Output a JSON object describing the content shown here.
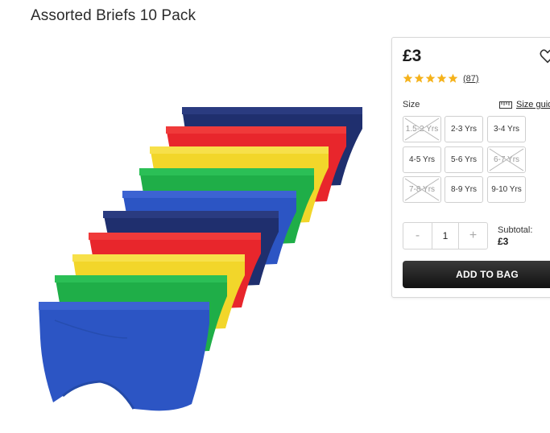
{
  "product": {
    "title": "Assorted Briefs 10 Pack",
    "image_alt": "Ten pairs of briefs in navy, red, yellow, green and blue"
  },
  "buy_box": {
    "price": "£3",
    "rating": {
      "stars": 5,
      "review_count": "(87)"
    },
    "size_label": "Size",
    "size_guide_label": "Size guid",
    "sizes": [
      {
        "label": "1.5-2 Yrs",
        "available": false
      },
      {
        "label": "2-3 Yrs",
        "available": true
      },
      {
        "label": "3-4 Yrs",
        "available": true
      },
      {
        "label": "4-5 Yrs",
        "available": true
      },
      {
        "label": "5-6 Yrs",
        "available": true
      },
      {
        "label": "6-7 Yrs",
        "available": false
      },
      {
        "label": "7-8 Yrs",
        "available": false
      },
      {
        "label": "8-9 Yrs",
        "available": true
      },
      {
        "label": "9-10 Yrs",
        "available": true
      }
    ],
    "quantity": {
      "minus": "-",
      "value": "1",
      "plus": "+"
    },
    "subtotal_label": "Subtotal:",
    "subtotal_value": "£3",
    "add_to_bag_label": "ADD TO BAG"
  },
  "colors": {
    "navy": "#1f2f6e",
    "red": "#e8262c",
    "yellow": "#f2d62a",
    "green": "#1fae48",
    "blue": "#2c55c4",
    "star": "#f5b21b"
  }
}
